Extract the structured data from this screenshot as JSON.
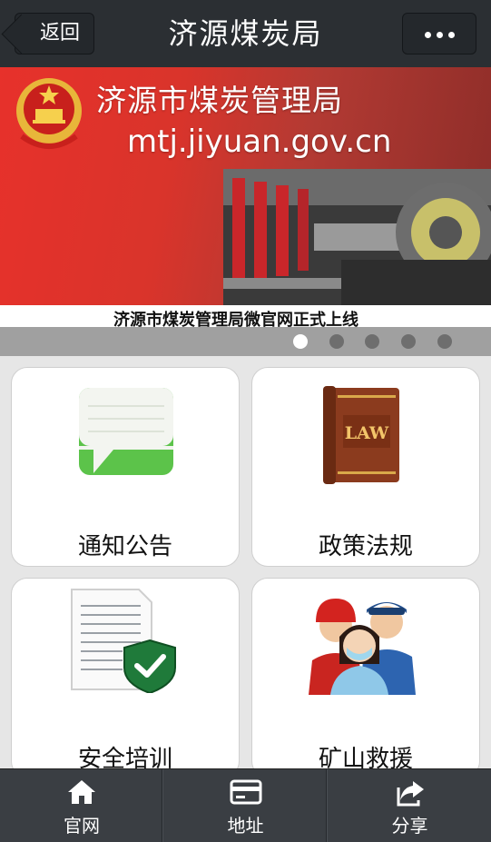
{
  "header": {
    "back_label": "返回",
    "title": "济源煤炭局",
    "more_icon": "more-icon"
  },
  "banner": {
    "heading": "济源市煤炭管理局",
    "url": "mtj.jiyuan.gov.cn",
    "caption": "济源市煤炭管理局微官网正式上线",
    "slide_count": 5,
    "active_slide": 1
  },
  "tiles": [
    {
      "label": "通知公告",
      "icon": "notice-icon"
    },
    {
      "label": "政策法规",
      "icon": "law-book-icon",
      "icon_text": "LAW"
    },
    {
      "label": "安全培训",
      "icon": "safety-document-icon"
    },
    {
      "label": "矿山救援",
      "icon": "rescue-staff-icon"
    }
  ],
  "tabbar": [
    {
      "label": "官网",
      "icon": "home-icon"
    },
    {
      "label": "地址",
      "icon": "card-icon"
    },
    {
      "label": "分享",
      "icon": "share-icon"
    }
  ],
  "colors": {
    "header_bg": "#2b2f33",
    "banner_red": "#e7312b",
    "tabbar_bg": "#3a3e43",
    "tile_green": "#5cc34a",
    "shield_green": "#1f7a3a"
  }
}
